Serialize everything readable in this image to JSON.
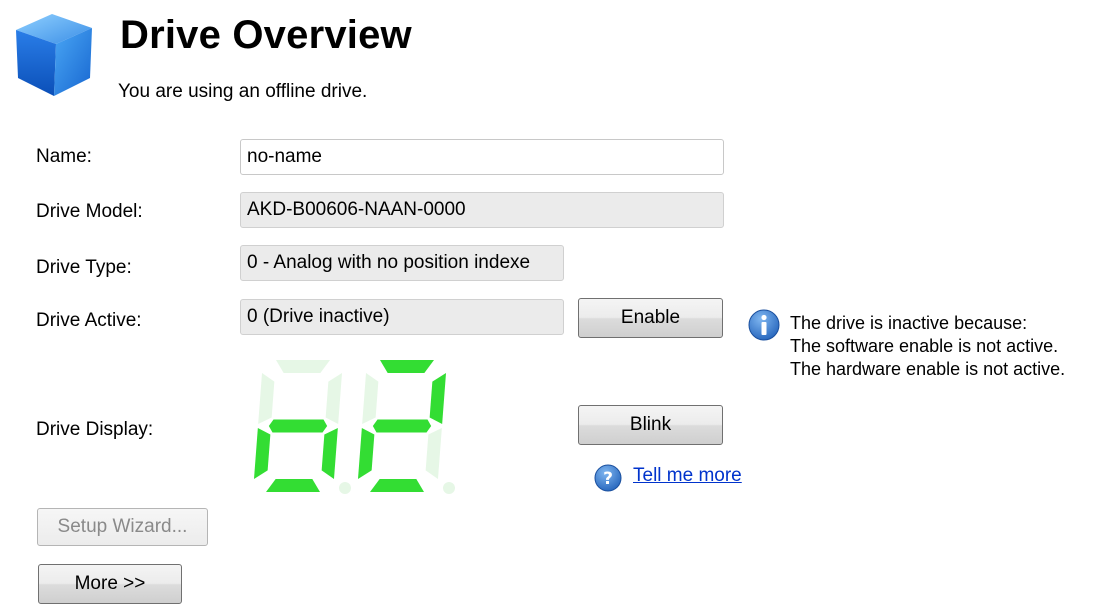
{
  "header": {
    "title": "Drive Overview",
    "subtitle": "You are using an offline drive.",
    "icon": "blue-cube-icon"
  },
  "fields": {
    "name": {
      "label": "Name:",
      "value": "no-name"
    },
    "model": {
      "label": "Drive Model:",
      "value": "AKD-B00606-NAAN-0000"
    },
    "type": {
      "label": "Drive Type:",
      "value": "0 - Analog with no position indexe"
    },
    "active": {
      "label": "Drive Active:",
      "value": "0 (Drive inactive)"
    },
    "display": {
      "label": "Drive Display:",
      "digits": "o2",
      "on_color": "#33dd33",
      "off_color": "#e6f7e6"
    }
  },
  "buttons": {
    "enable": "Enable",
    "blink": "Blink",
    "setup_wizard": "Setup Wizard...",
    "more": "More >>"
  },
  "info": {
    "icon": "info-icon",
    "lines": [
      "The drive is inactive because:",
      "The software enable is not active.",
      "The hardware enable is not active."
    ]
  },
  "help": {
    "icon": "help-icon",
    "link_text": "Tell me more"
  },
  "colors": {
    "accent_blue": "#1f6fd6",
    "link": "#0033cc"
  }
}
